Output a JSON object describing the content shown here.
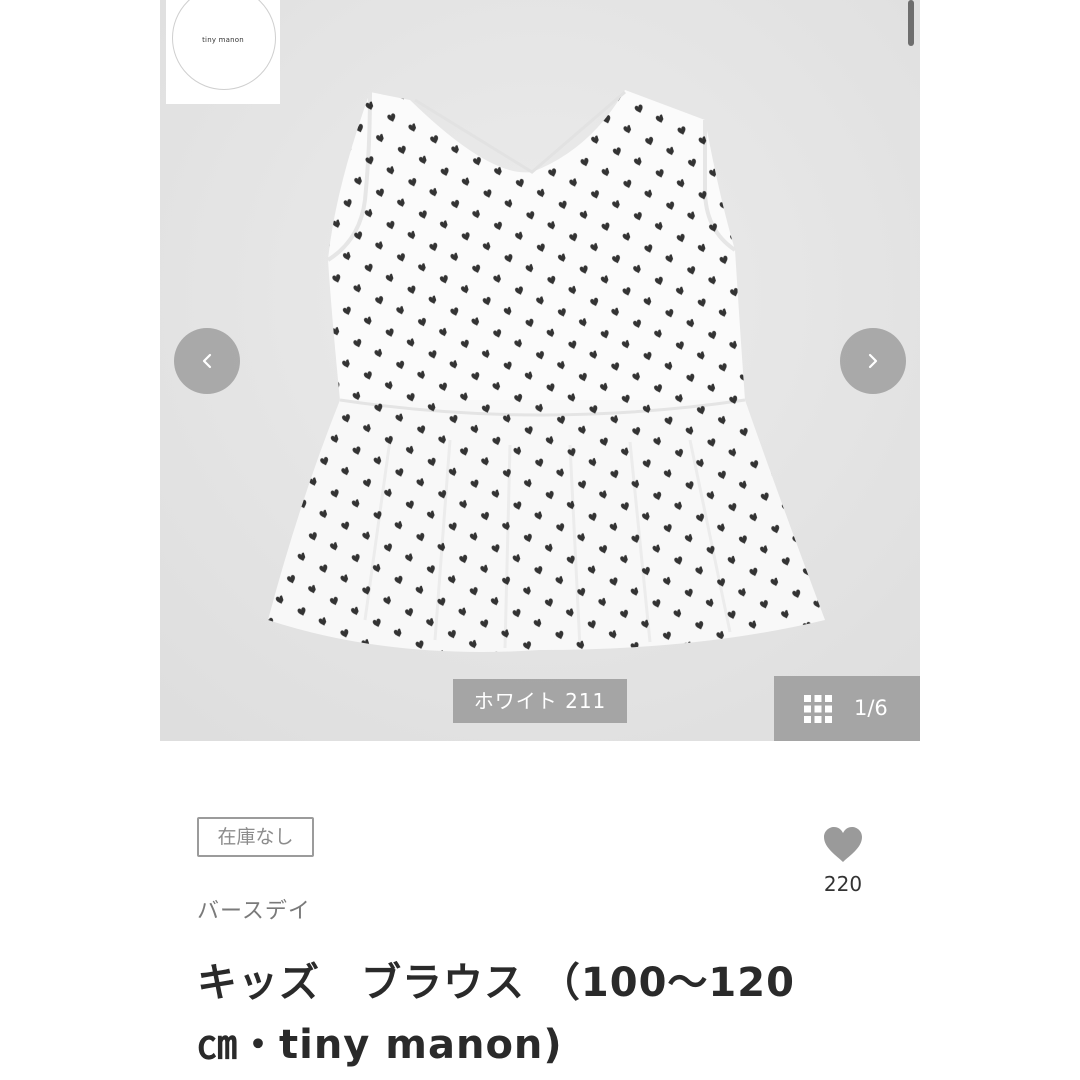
{
  "gallery": {
    "brand_logo_text": "tiny manon",
    "color_label": "ホワイト 211",
    "image_counter": "1/6",
    "prev_icon": "chevron-left-icon",
    "next_icon": "chevron-right-icon",
    "grid_icon": "grid-icon"
  },
  "product": {
    "stock_status": "在庫なし",
    "favorite_count": "220",
    "favorite_icon": "heart-icon",
    "shop_name": "バースデイ",
    "title": "キッズ　ブラウス （100〜120 ㎝・tiny manon)"
  },
  "colors": {
    "badge_border": "#9b9b9b",
    "heart": "#9a9a9a",
    "overlay": "#969696",
    "title_text": "#2a2a2a"
  }
}
